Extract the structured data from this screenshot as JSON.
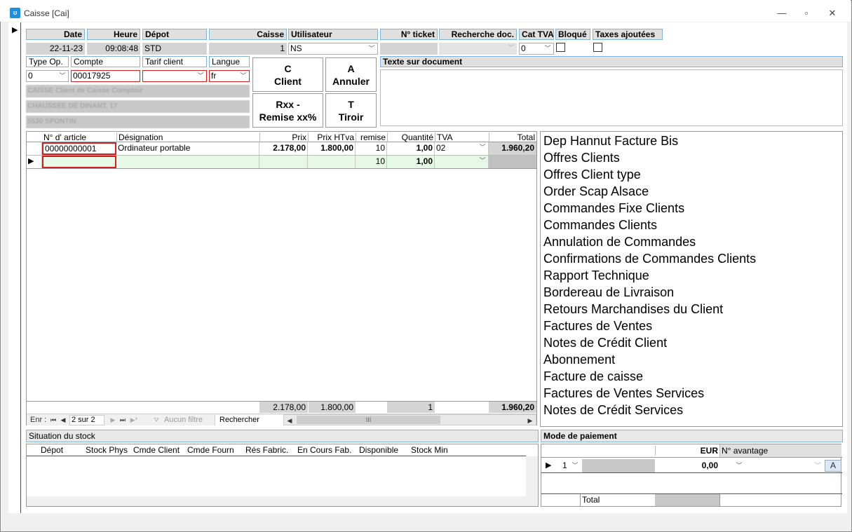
{
  "window": {
    "title": "Caisse [Cai]",
    "app_icon": "cash-register-icon"
  },
  "header": {
    "labels": {
      "date": "Date",
      "heure": "Heure",
      "depot": "Dépot",
      "caisse": "Caisse",
      "utilisateur": "Utilisateur",
      "ticket": "N° ticket",
      "recherche": "Recherche doc.",
      "cat_tva": "Cat TVA",
      "bloque": "Bloqué",
      "taxes": "Taxes ajoutées"
    },
    "values": {
      "date": "22-11-23",
      "heure": "09:08:48",
      "depot": "STD",
      "caisse": "1",
      "utilisateur": "NS",
      "ticket": "",
      "recherche": "",
      "cat_tva": "0"
    }
  },
  "client": {
    "labels": {
      "type_op": "Type Op.",
      "compte": "Compte",
      "tarif": "Tarif client",
      "langue": "Langue"
    },
    "values": {
      "type_op": "0",
      "compte": "00017925",
      "tarif": "",
      "langue": "fr"
    },
    "address": [
      "CAISSE Client de Caisse Comptoir",
      "CHAUSSEE DE DINANT, 17",
      "5530  SPONTIN"
    ]
  },
  "actions": {
    "client": [
      "C",
      "Client"
    ],
    "annuler": [
      "A",
      "Annuler"
    ],
    "remise": [
      "Rxx -",
      "Remise xx%"
    ],
    "tiroir": [
      "T",
      "Tiroir"
    ]
  },
  "texte_doc": {
    "label": "Texte sur document",
    "value": ""
  },
  "grid": {
    "headers": [
      "N° d' article",
      "Désignation",
      "Prix",
      "Prix HTva",
      "remise",
      "Quantité",
      "TVA",
      "Total"
    ],
    "rows": [
      {
        "article": "00000000001",
        "designation": "Ordinateur portable",
        "prix": "2.178,00",
        "prix_htva": "1.800,00",
        "remise": "10",
        "quantite": "1,00",
        "tva": "02",
        "total": "1.960,20"
      },
      {
        "article": "",
        "designation": "",
        "prix": "",
        "prix_htva": "",
        "remise": "10",
        "quantite": "1,00",
        "tva": "",
        "total": ""
      }
    ],
    "totals": {
      "prix": "2.178,00",
      "prix_htva": "1.800,00",
      "quantite": "1",
      "total": "1.960,20"
    },
    "nav": {
      "enr_label": "Enr :",
      "position": "2 sur 2",
      "filter": "Aucun filtre",
      "search": "Rechercher",
      "scroll_mark": "III"
    }
  },
  "documents": [
    "Dep Hannut Facture Bis",
    "Offres Clients",
    "Offres Client type",
    "Order Scap Alsace",
    "Commandes Fixe Clients",
    "Commandes Clients",
    "Annulation de Commandes",
    "Confirmations de Commandes Clients",
    "Rapport Technique",
    "Bordereau de Livraison",
    "Retours Marchandises du Client",
    "Factures de Ventes",
    "Notes de Crédit Client",
    "Abonnement",
    "Facture de caisse",
    "Factures de Ventes Services",
    "Notes de Crédit Services"
  ],
  "stock": {
    "title": "Situation du stock",
    "columns": [
      "Dépot",
      "Stock Phys",
      "Cmde Client",
      "Cmde Fourn",
      "Rés Fabric.",
      "En Cours Fab.",
      "Disponible",
      "Stock Min"
    ]
  },
  "payment": {
    "title": "Mode de paiement",
    "col_eur": "EUR",
    "col_avantage": "N° avantage",
    "row": {
      "num": "1",
      "amount": "0,00",
      "btn": "A"
    },
    "total_label": "Total"
  }
}
